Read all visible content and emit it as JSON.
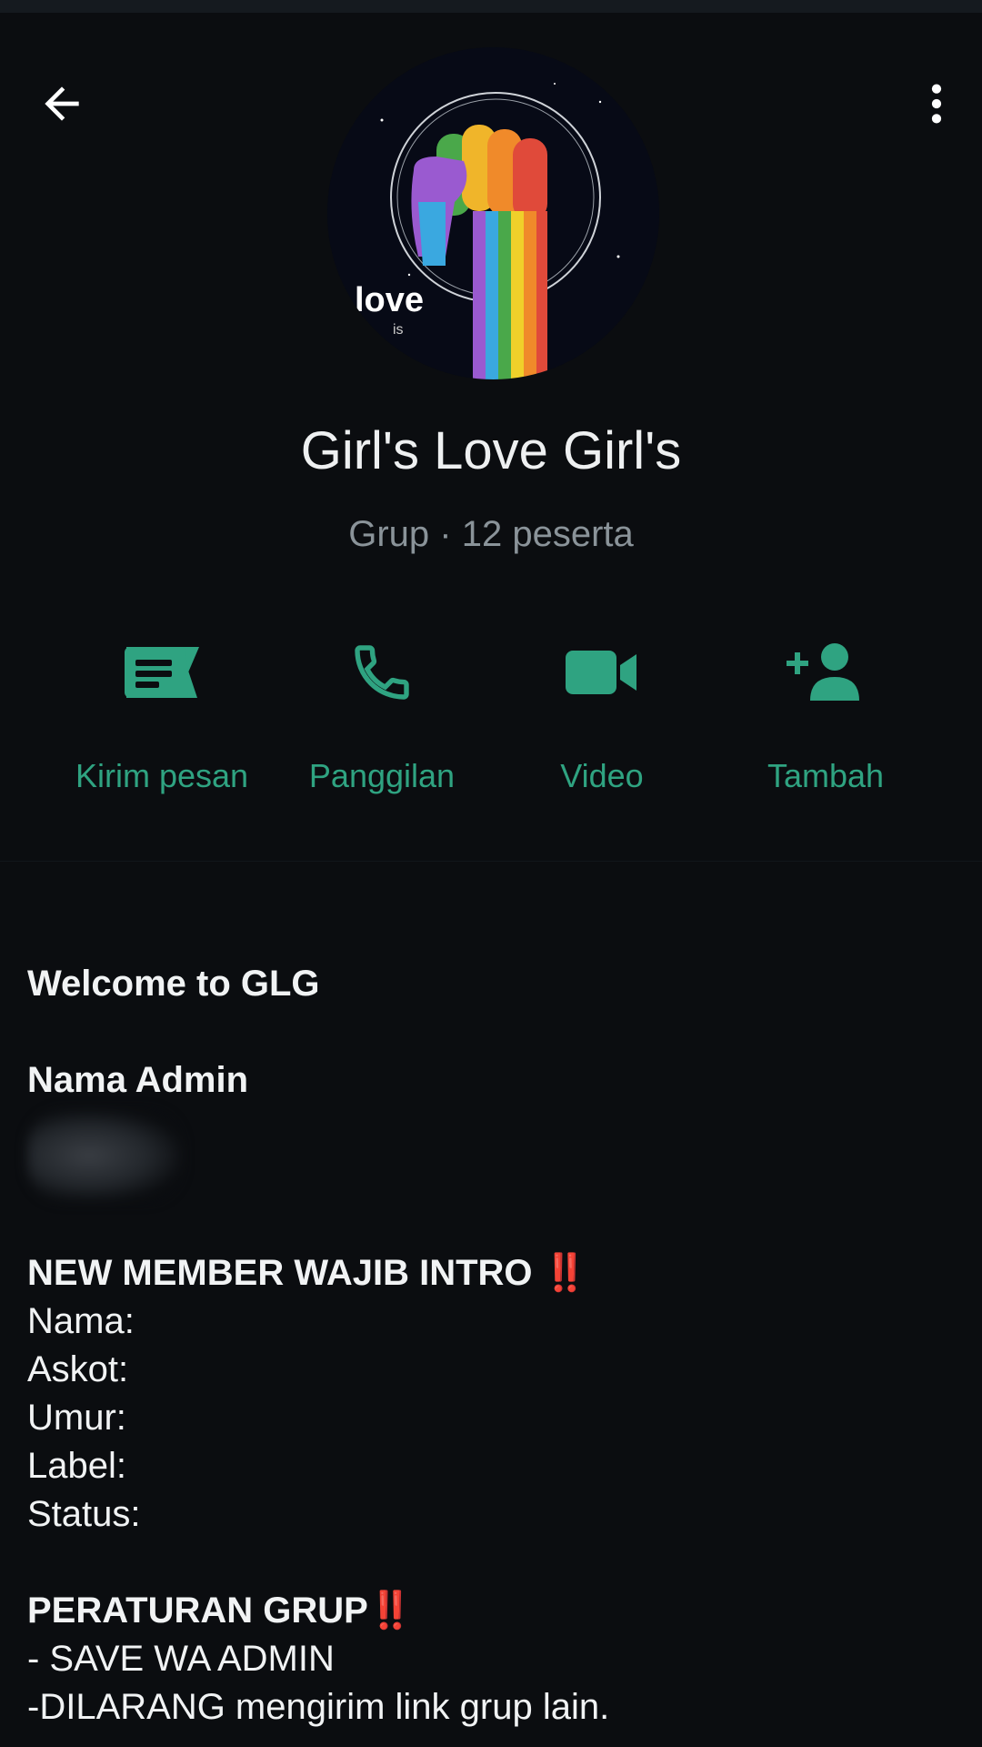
{
  "header": {
    "group_name": "Girl's Love Girl's",
    "group_meta": "Grup · 12 peserta",
    "avatar_text_main": "love",
    "avatar_text_small": "is"
  },
  "actions": [
    {
      "label": "Kirim pesan",
      "icon": "message-icon"
    },
    {
      "label": "Panggilan",
      "icon": "phone-icon"
    },
    {
      "label": "Video",
      "icon": "video-camera-icon"
    },
    {
      "label": "Tambah",
      "icon": "add-person-icon"
    }
  ],
  "description": {
    "welcome": "Welcome to GLG",
    "admin_heading": "Nama Admin",
    "intro_heading": "NEW MEMBER WAJIB INTRO",
    "intro_mark": "‼️",
    "intro_fields": [
      "Nama:",
      "Askot:",
      "Umur:",
      "Label:",
      "Status:"
    ],
    "rules_heading": "PERATURAN GRUP",
    "rules_mark": "‼️",
    "rules": [
      "- SAVE WA ADMIN",
      "-DILARANG mengirim link grup lain."
    ]
  },
  "colors": {
    "accent": "#2fa381",
    "background": "#0b0d10",
    "secondary_text": "#8a9399",
    "alert": "#e0302a"
  }
}
